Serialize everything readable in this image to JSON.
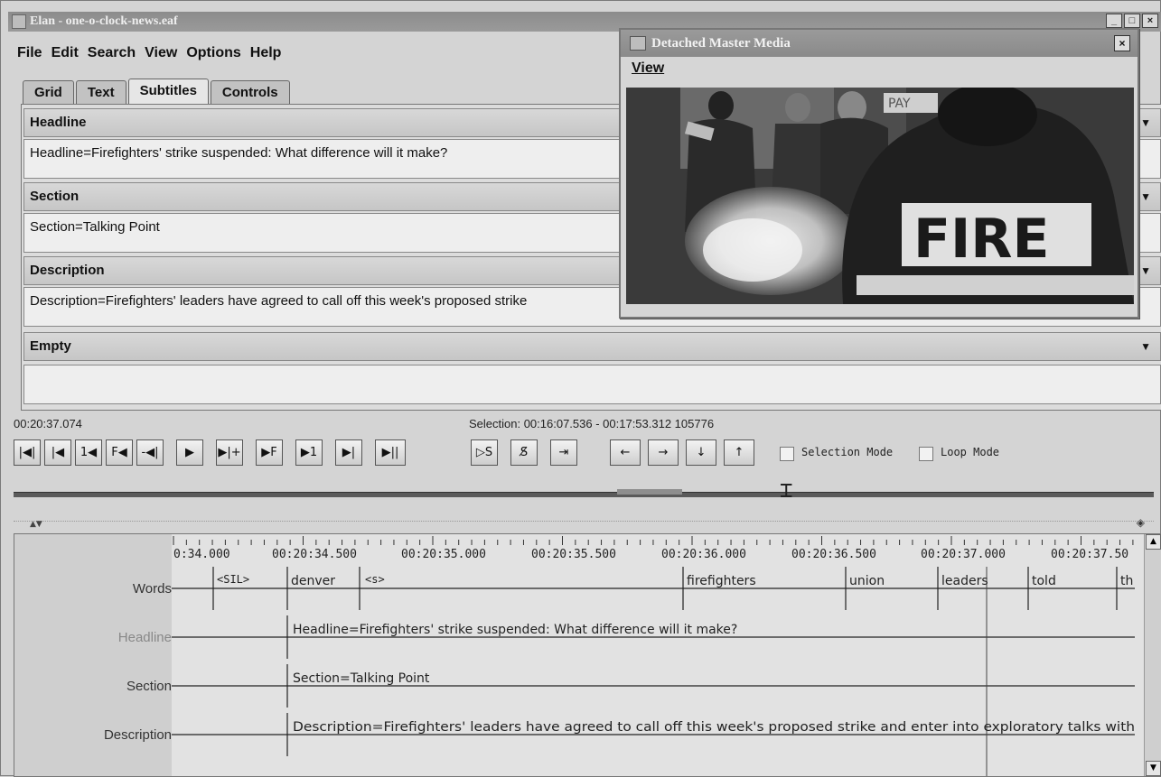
{
  "window": {
    "title": "Elan - one-o-clock-news.eaf",
    "buttons": [
      "_",
      "□",
      "×"
    ]
  },
  "menu": [
    "File",
    "Edit",
    "Search",
    "View",
    "Options",
    "Help"
  ],
  "tabs": [
    {
      "label": "Grid"
    },
    {
      "label": "Text"
    },
    {
      "label": "Subtitles",
      "active": true
    },
    {
      "label": "Controls"
    }
  ],
  "subtitles": [
    {
      "tier": "Headline",
      "text": "Headline=Firefighters' strike suspended: What difference will it make?"
    },
    {
      "tier": "Section",
      "text": "Section=Talking Point"
    },
    {
      "tier": "Description",
      "text": "Description=Firefighters' leaders have agreed to call off this week's proposed strike"
    },
    {
      "tier": "Empty",
      "text": ""
    }
  ],
  "media_window": {
    "title": "Detached Master Media",
    "menu": "View",
    "close": "×"
  },
  "player": {
    "current_time": "00:20:37.074",
    "selection": "Selection: 00:16:07.536 - 00:17:53.312  105776",
    "buttons": [
      "|◀|",
      "|◀",
      "1◀",
      "F◀",
      "-◀|",
      "▶",
      "▶|+",
      "▶F",
      "▶1",
      "▶|",
      "▶||"
    ],
    "sel_buttons": [
      "▷S",
      "S̸",
      "⇥"
    ],
    "arrow_buttons": [
      "←",
      "→",
      "↓",
      "↑"
    ],
    "selection_mode": "Selection Mode",
    "loop_mode": "Loop Mode",
    "selection_mode_checked": false,
    "loop_mode_checked": false
  },
  "timeline": {
    "ticks": [
      "0:34.000",
      "00:20:34.500",
      "00:20:35.000",
      "00:20:35.500",
      "00:20:36.000",
      "00:20:36.500",
      "00:20:37.000",
      "00:20:37.50"
    ],
    "tiers": [
      {
        "name": "Words",
        "style": "dark"
      },
      {
        "name": "Headline",
        "style": "light"
      },
      {
        "name": "Section",
        "style": "dark"
      },
      {
        "name": "Description",
        "style": "dark"
      }
    ],
    "words": [
      "<SIL>",
      "denver",
      "<s>",
      "firefighters",
      "union",
      "leaders",
      "told",
      "th"
    ],
    "headline": "Headline=Firefighters' strike suspended: What difference will it make?",
    "section": "Section=Talking Point",
    "description": "Description=Firefighters' leaders have agreed to call off this week's proposed strike and enter into exploratory talks with"
  }
}
